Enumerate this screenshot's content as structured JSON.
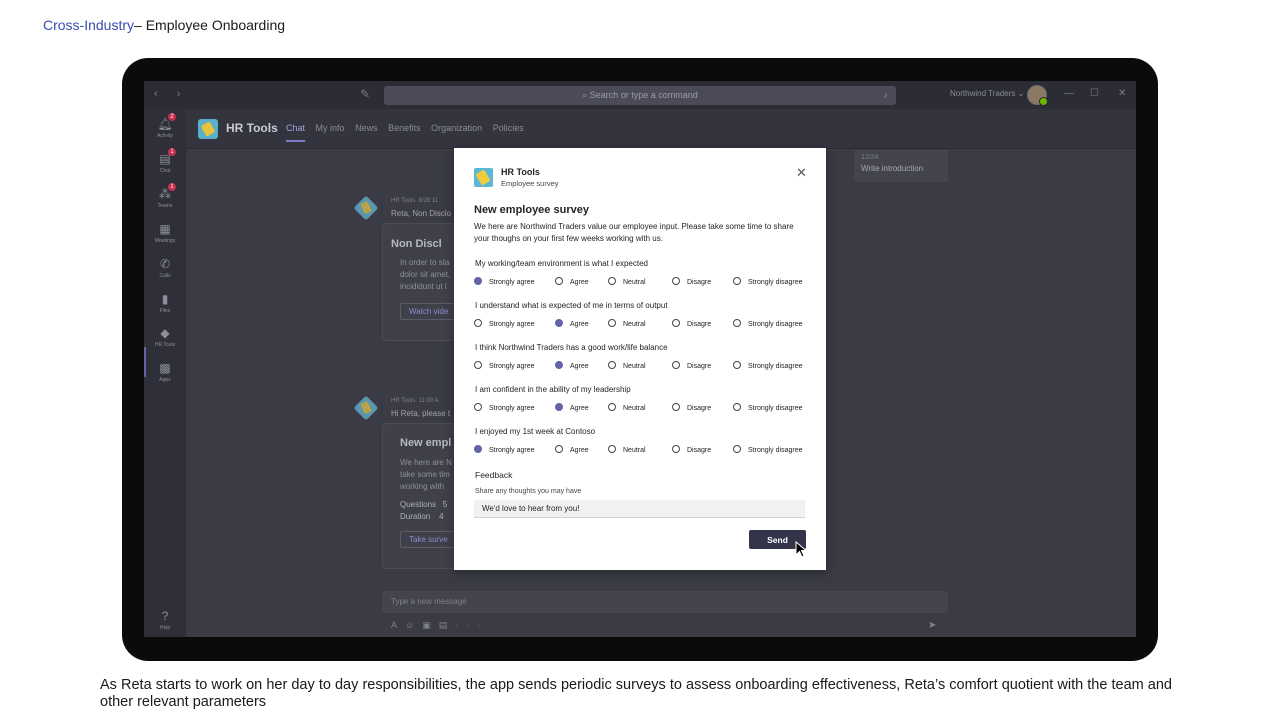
{
  "header": {
    "prefix": "Cross-Industry",
    "suffix": "– Employee Onboarding"
  },
  "caption": "As Reta starts to work on her day to day responsibilities, the app sends periodic surveys to assess onboarding effectiveness, Reta’s comfort quotient with the team and other relevant parameters",
  "teams": {
    "search_placeholder": "Search or type a command",
    "org_name": "Northwind Traders",
    "rail": [
      {
        "label": "Activity",
        "icon": "bell-icon",
        "badge": "2"
      },
      {
        "label": "Chat",
        "icon": "chat-icon",
        "badge": "1"
      },
      {
        "label": "Teams",
        "icon": "teams-icon",
        "badge": "1"
      },
      {
        "label": "Meetings",
        "icon": "calendar-icon",
        "badge": ""
      },
      {
        "label": "Calls",
        "icon": "phone-icon",
        "badge": ""
      },
      {
        "label": "Files",
        "icon": "files-icon",
        "badge": ""
      },
      {
        "label": "HR Tools",
        "icon": "hr-tools-icon",
        "badge": ""
      },
      {
        "label": "Apps",
        "icon": "apps-icon",
        "badge": ""
      }
    ],
    "help_label": "Help",
    "app_title": "HR Tools",
    "tabs": [
      "Chat",
      "My info",
      "News",
      "Benefits",
      "Organization",
      "Policies"
    ],
    "task": {
      "date": "12/24",
      "title": "Write introduction"
    },
    "messages": [
      {
        "sender": "HR Tools",
        "time": "8/28 11",
        "text": "Reta, Non Disclo",
        "card_title": "Non Discl",
        "card_lines": [
          "In order to sta",
          "dolor sit amet,",
          "incididunt ut l"
        ],
        "button": "Watch vide"
      },
      {
        "sender": "HR Tools",
        "time": "11:00 A",
        "text": "Hi Reta, please t",
        "card_title": "New empl",
        "card_lines": [
          "We here are N",
          "take some tim",
          "working with"
        ],
        "rows": [
          {
            "label": "Questions",
            "value": "5"
          },
          {
            "label": "Duration",
            "value": "4"
          }
        ],
        "button": "Take surve"
      }
    ],
    "compose_placeholder": "Type a new message"
  },
  "dialog": {
    "app_name": "HR Tools",
    "subtitle": "Employee survey",
    "title": "New employee survey",
    "intro": "We here are Northwind Traders value our employee input. Please take some time to share your thoughs on your first few weeks working with us.",
    "options": [
      "Strongly agree",
      "Agree",
      "Neutral",
      "Disagre",
      "Strongly disagree"
    ],
    "questions": [
      {
        "text": "My working/team environment is what I expected",
        "selected": 0
      },
      {
        "text": "I understand what is expected of me in terms of output",
        "selected": 1
      },
      {
        "text": "I think Northwind Traders has a good work/life balance",
        "selected": 1
      },
      {
        "text": "I am confident in the ability of my leadership",
        "selected": 1
      },
      {
        "text": "I enjoyed my 1st week at Contoso",
        "selected": 0
      }
    ],
    "feedback_label": "Feedback",
    "feedback_hint": "Share any thoughts you may have",
    "feedback_value": "We'd love to hear from you!",
    "send_label": "Send"
  }
}
